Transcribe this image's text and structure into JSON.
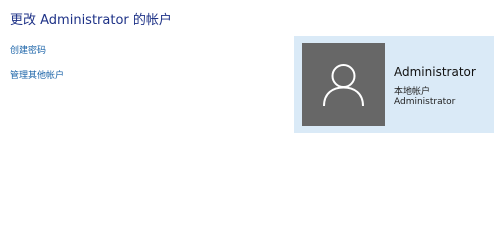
{
  "header": {
    "title": "更改 Administrator 的帐户"
  },
  "tasks": {
    "create_password": "创建密码",
    "manage_other": "管理其他帐户"
  },
  "account": {
    "name": "Administrator",
    "type": "本地帐户",
    "group": "Administrator",
    "avatar_icon": "user-silhouette-icon",
    "card_color": "#daeaf7",
    "avatar_bg": "#676767"
  }
}
